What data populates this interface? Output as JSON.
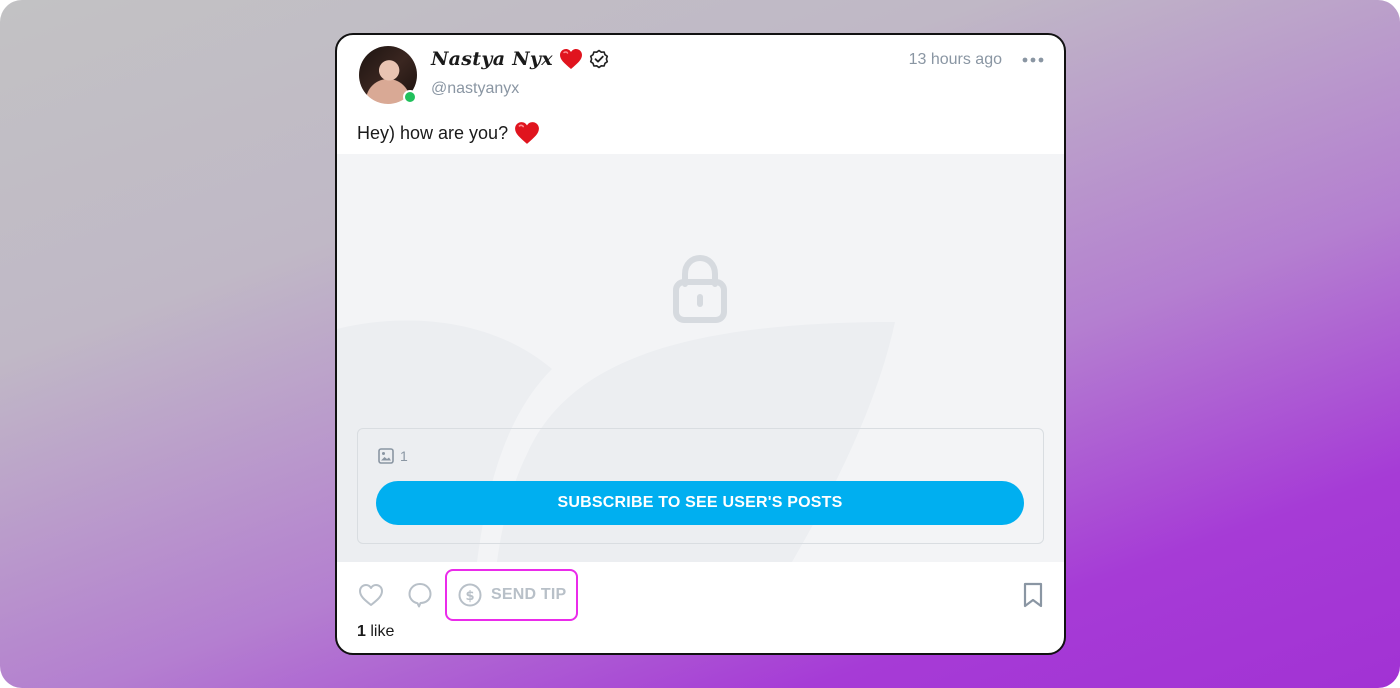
{
  "post": {
    "author": {
      "display_name": "Nastya Nyx",
      "handle": "@nastyanyx",
      "online": true,
      "verified": true
    },
    "timestamp": "13 hours ago",
    "text": "Hey) how are you?",
    "media": {
      "locked": true,
      "image_count": "1",
      "subscribe_label": "SUBSCRIBE TO SEE USER'S POSTS"
    },
    "actions": {
      "send_tip_label": "SEND TIP"
    },
    "likes": {
      "count": "1",
      "label": "like"
    }
  },
  "colors": {
    "accent": "#00aff0",
    "highlight": "#ea2bea",
    "online": "#20c05c",
    "muted": "#8a96a3"
  },
  "icons": [
    "heart-emoji",
    "verified-icon",
    "more-icon",
    "lock-icon",
    "image-icon",
    "heart-outline-icon",
    "comment-icon",
    "dollar-icon",
    "bookmark-icon"
  ]
}
